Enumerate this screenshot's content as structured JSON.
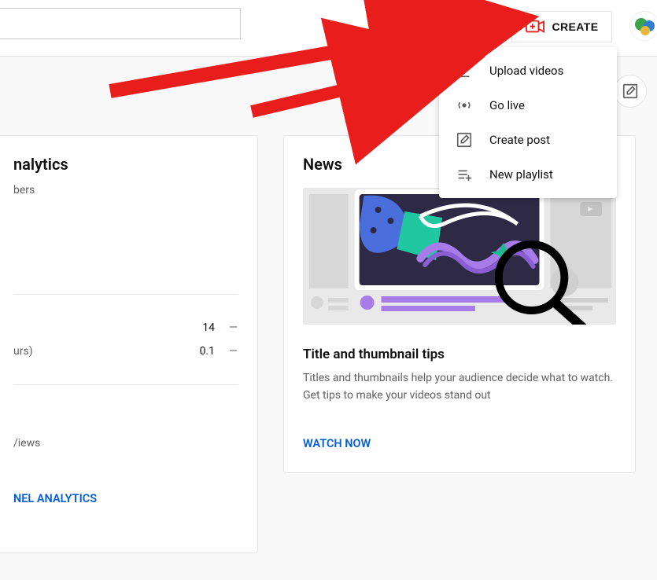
{
  "header": {
    "search_placeholder": "",
    "create_label": "CREATE"
  },
  "create_menu": {
    "items": [
      {
        "label": "Upload videos"
      },
      {
        "label": "Go live"
      },
      {
        "label": "Create post"
      },
      {
        "label": "New playlist"
      }
    ]
  },
  "analytics": {
    "title_fragment": "nalytics",
    "subscribers_fragment": "bers",
    "rows": [
      {
        "label": "",
        "value": "14",
        "dash": "—"
      },
      {
        "label_fragment": "urs)",
        "value": "0.1",
        "dash": "—"
      }
    ],
    "top_views_fragment": "/iews",
    "cta_fragment": "NEL ANALYTICS"
  },
  "news": {
    "heading": "News",
    "article_title": "Title and thumbnail tips",
    "article_body": "Titles and thumbnails help your audience decide what to watch. Get tips to make your videos stand out",
    "cta": "WATCH NOW"
  },
  "colors": {
    "link_blue": "#065fd4",
    "arrow_red": "#ea1d1d"
  }
}
